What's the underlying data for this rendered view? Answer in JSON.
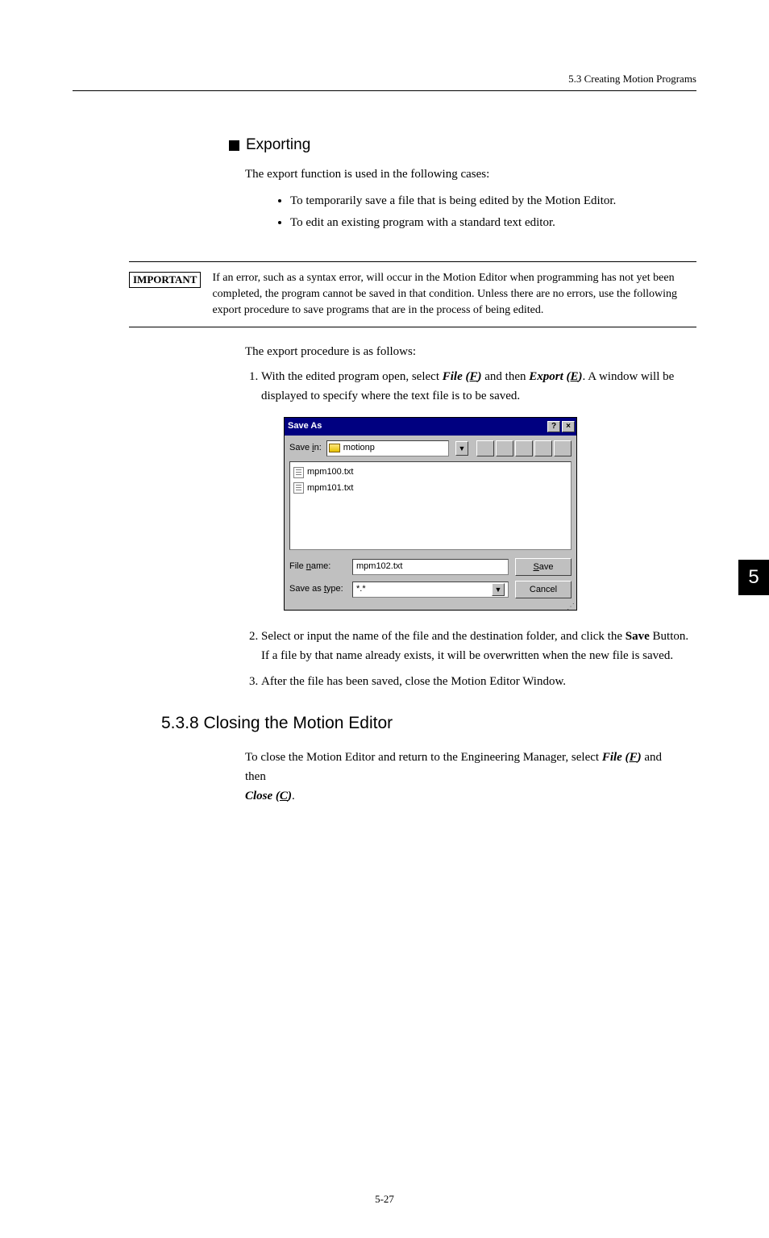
{
  "header": {
    "section_ref": "5.3  Creating Motion Programs"
  },
  "exporting": {
    "title": "Exporting",
    "intro": "The export function is used in the following cases:",
    "bullets": [
      "To temporarily save a file that is being edited by the Motion Editor.",
      "To edit an existing program with a standard text editor."
    ]
  },
  "important": {
    "label": "IMPORTANT",
    "text": "If an error, such as a syntax error, will occur in the Motion Editor when programming has not yet been completed, the program cannot be saved in that condition. Unless there are no errors, use the following export procedure to save programs that are in the process of being edited."
  },
  "procedure": {
    "intro": "The export procedure is as follows:",
    "step1_a": "With the edited program open, select ",
    "step1_file": "File (",
    "step1_file_key": "F",
    "step1_b": ")",
    "step1_c": " and then ",
    "step1_export": "Export (",
    "step1_export_key": "E",
    "step1_d": ")",
    "step1_e": ". A window will be displayed to specify where the text file is to be saved.",
    "step2_a": "Select or input the name of the file and the destination folder, and click the ",
    "step2_btn": "Save",
    "step2_b": " Button. If a file by that name already exists, it will be overwritten when the new file is saved.",
    "step3": "After the file has been saved, close the Motion Editor Window."
  },
  "dialog": {
    "title": "Save As",
    "save_in_label": "Save in:",
    "folder": "motionp",
    "files": [
      "mpm100.txt",
      "mpm101.txt"
    ],
    "filename_label_pre": "File ",
    "filename_label_u": "n",
    "filename_label_post": "ame:",
    "filename_value": "mpm102.txt",
    "type_label_pre": "Save as ",
    "type_label_u": "t",
    "type_label_post": "ype:",
    "type_value": "*.*",
    "save_btn_u": "S",
    "save_btn_rest": "ave",
    "cancel_btn": "Cancel"
  },
  "closing": {
    "heading": "5.3.8  Closing the Motion Editor",
    "text_a": "To close the Motion Editor and return to the Engineering Manager, select ",
    "file": "File (",
    "file_key": "F",
    "file_close": ")",
    "text_b": " and then ",
    "close": "Close (",
    "close_key": "C",
    "close_end": ")",
    "period": "."
  },
  "sidetab": "5",
  "page_number": "5-27"
}
